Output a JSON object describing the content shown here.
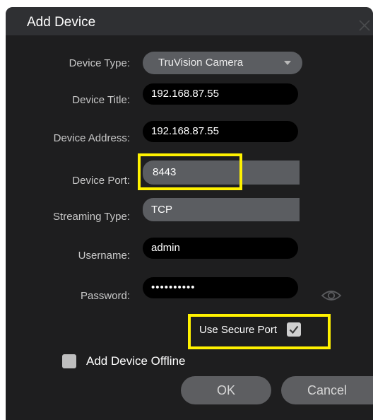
{
  "dialog": {
    "title": "Add Device"
  },
  "fields": {
    "device_type": {
      "label": "Device Type:",
      "value": "TruVision Camera"
    },
    "device_title": {
      "label": "Device Title:",
      "value": "192.168.87.55"
    },
    "device_address": {
      "label": "Device Address:",
      "value": "192.168.87.55"
    },
    "device_port": {
      "label": "Device Port:",
      "value": "8443"
    },
    "streaming_type": {
      "label": "Streaming Type:",
      "value": "TCP"
    },
    "username": {
      "label": "Username:",
      "value": "admin"
    },
    "password": {
      "label": "Password:",
      "value": "••••••••••"
    }
  },
  "options": {
    "use_secure_port": {
      "label": "Use Secure Port",
      "checked": true
    },
    "add_device_offline": {
      "label": "Add Device Offline",
      "checked": false
    }
  },
  "buttons": {
    "ok": "OK",
    "cancel": "Cancel"
  },
  "icons": {
    "close": "close-icon",
    "eye": "eye-icon",
    "dropdown": "chevron-down-icon",
    "check": "checkmark-icon"
  },
  "colors": {
    "highlight": "#fff200",
    "dialog_bg": "#1e1e1f",
    "field_bg": "#000000",
    "readonly_field_bg": "#5b5d61"
  }
}
